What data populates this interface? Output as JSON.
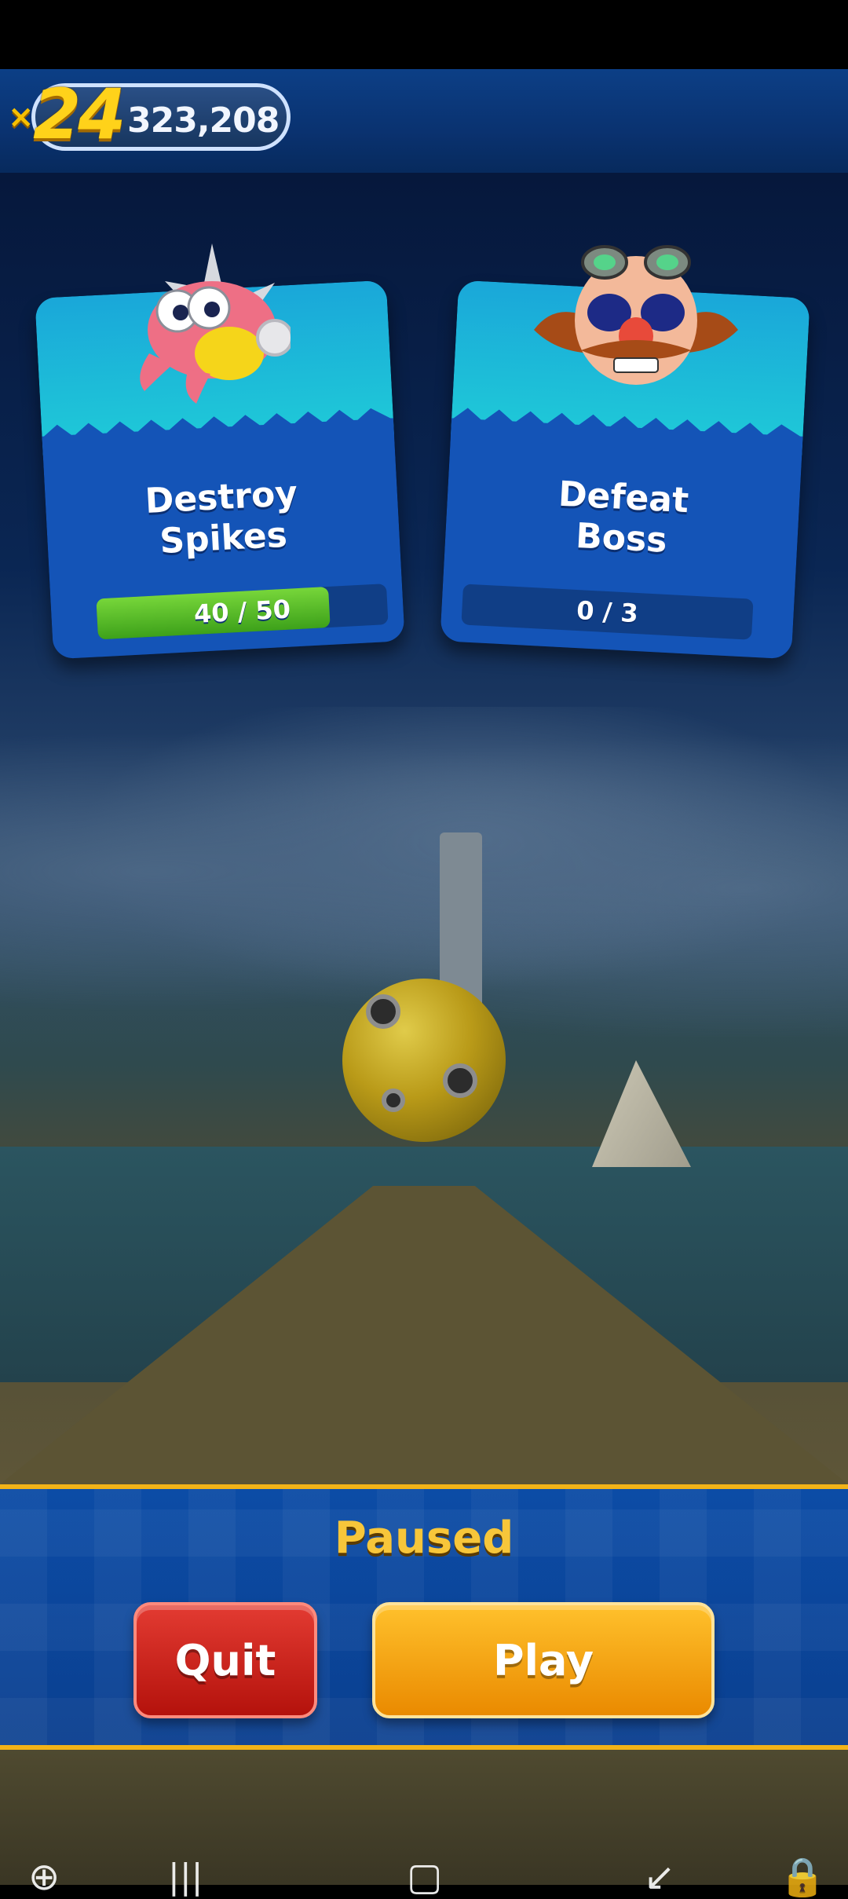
{
  "hud": {
    "multiplier_prefix": "×",
    "multiplier": "24",
    "score": "323,208"
  },
  "missions": [
    {
      "title_line1": "Destroy",
      "title_line2": "Spikes",
      "progress_text": "40 / 50",
      "progress_fraction": 0.8,
      "icon": "spikes-badnik-icon"
    },
    {
      "title_line1": "Defeat",
      "title_line2": "Boss",
      "progress_text": "0 / 3",
      "progress_fraction": 0.0,
      "icon": "eggman-face-icon"
    }
  ],
  "pause_menu": {
    "title": "Paused",
    "quit_label": "Quit",
    "play_label": "Play"
  },
  "colors": {
    "accent_gold": "#f2b318",
    "quit_red": "#c9201a",
    "play_orange": "#f5a30f",
    "card_blue": "#1454b7",
    "progress_green": "#4fb526"
  },
  "navigation_icons": [
    "add-icon",
    "recents-icon",
    "home-icon",
    "back-icon",
    "lock-icon"
  ]
}
